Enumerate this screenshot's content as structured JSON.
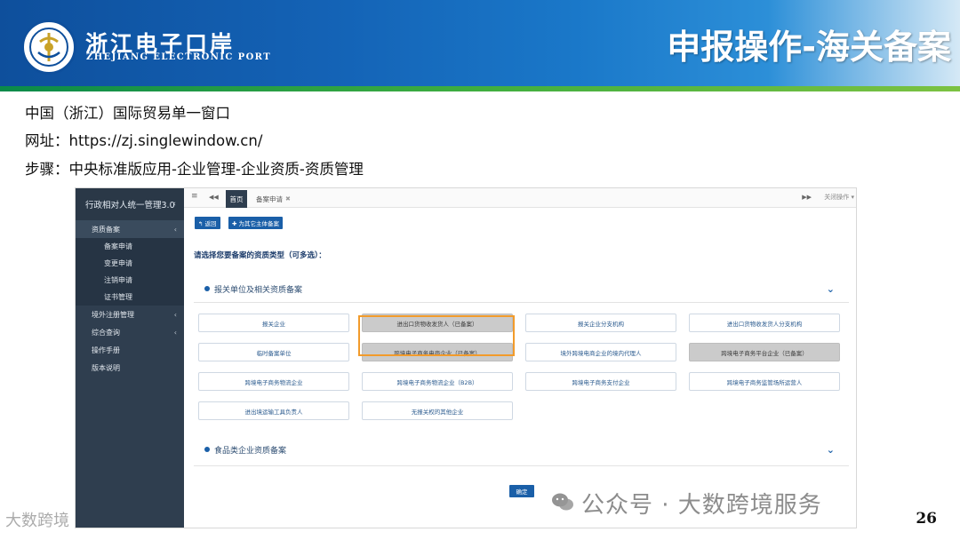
{
  "header": {
    "brand_cn": "浙江电子口岸",
    "brand_en": "ZHEJIANG ELECTRONIC PORT",
    "slide_title": "申报操作-海关备案"
  },
  "info": {
    "line1": "中国（浙江）国际贸易单一窗口",
    "line2": "网址：https://zj.singlewindow.cn/",
    "line3": "步骤：中央标准版应用-企业管理-企业资质-资质管理"
  },
  "app": {
    "sidebar": {
      "title": "行政相对人统一管理3.0",
      "title_chevron": "‹",
      "groups": [
        {
          "label": "资质备案",
          "chevron": "‹",
          "active": true
        },
        {
          "label": "境外注册管理",
          "chevron": "‹"
        },
        {
          "label": "综合查询",
          "chevron": "‹"
        },
        {
          "label": "操作手册",
          "chevron": ""
        },
        {
          "label": "版本说明",
          "chevron": ""
        }
      ],
      "sub_items": [
        "备案申请",
        "变更申请",
        "注销申请",
        "证书管理"
      ]
    },
    "tabs": {
      "home": "首页",
      "current": "备案申请",
      "current_close": "✖",
      "close_ops": "关闭操作 ▾",
      "menu_icon": "≡",
      "back_icon": "◀◀",
      "fwd_icon": "▶▶"
    },
    "buttons": {
      "back": "↰ 返回",
      "other_subject": "✚ 为其它主体备案",
      "confirm": "确定"
    },
    "question": "请选择您要备案的资质类型（可多选）：",
    "sections": [
      {
        "title": "报关单位及相关资质备案",
        "chevron": "⌄",
        "options": [
          {
            "label": "报关企业",
            "selected": false
          },
          {
            "label": "进出口货物收发货人（已备案）",
            "selected": true
          },
          {
            "label": "报关企业分支机构",
            "selected": false
          },
          {
            "label": "进出口货物收发货人分支机构",
            "selected": false
          },
          {
            "label": "临时备案单位",
            "selected": false
          },
          {
            "label": "跨境电子商务电商企业（已备案）",
            "selected": true
          },
          {
            "label": "境外跨境电商企业的境内代理人",
            "selected": false
          },
          {
            "label": "跨境电子商务平台企业（已备案）",
            "selected": true
          },
          {
            "label": "跨境电子商务物流企业",
            "selected": false
          },
          {
            "label": "跨境电子商务物流企业（B2B）",
            "selected": false
          },
          {
            "label": "跨境电子商务支付企业",
            "selected": false
          },
          {
            "label": "跨境电子商务监管场所运营人",
            "selected": false
          },
          {
            "label": "进出境运输工具负责人",
            "selected": false
          },
          {
            "label": "无报关权的其他企业",
            "selected": false
          }
        ]
      },
      {
        "title": "食品类企业资质备案",
        "chevron": "⌄"
      }
    ],
    "highlight_color": "#f29b2b"
  },
  "watermark": {
    "text": "公众号 · 大数跨境服务",
    "left_text": "大数跨境"
  },
  "page_number": "26",
  "colors": {
    "brand_blue": "#1463b6",
    "sidebar_bg": "#2f3e4f",
    "button_blue": "#1a5fa8",
    "accent_green": "#3fae3f"
  }
}
